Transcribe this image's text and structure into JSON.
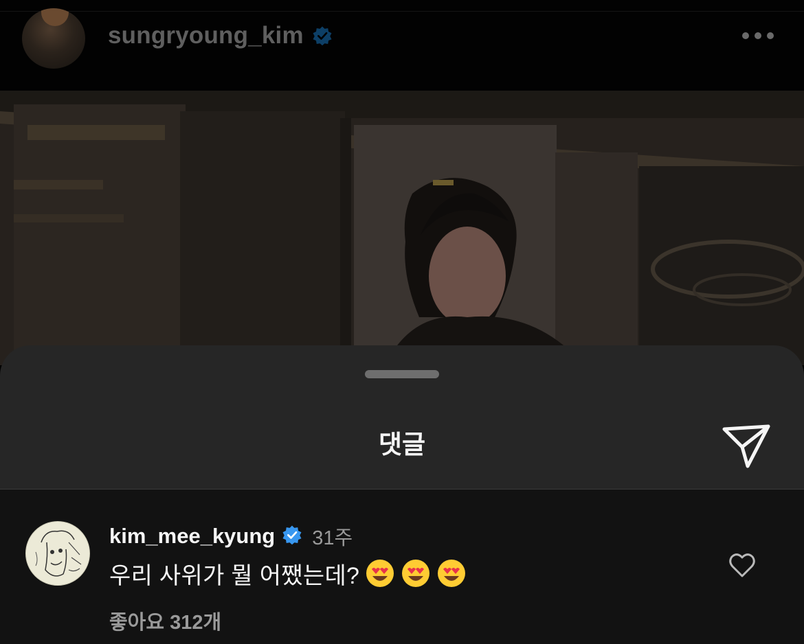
{
  "post": {
    "username": "sungryoung_kim",
    "verified": true,
    "more_icon": "ellipsis-icon",
    "photo_description_icon": "post-photo"
  },
  "comments_sheet": {
    "title": "댓글",
    "share_icon": "paper-plane-icon"
  },
  "comment": {
    "username": "kim_mee_kyung",
    "verified": true,
    "time": "31주",
    "text": "우리 사위가 뭘 어쨌는데?",
    "emojis": [
      "heart-eyes-emoji",
      "heart-eyes-emoji",
      "heart-eyes-emoji"
    ],
    "likes": "좋아요 312개",
    "like_icon": "heart-outline-icon"
  },
  "colors": {
    "sheet_bg": "#262626",
    "comment_bg": "#121212",
    "verified_blue": "#3897f0",
    "text_primary": "#f5f5f5",
    "text_secondary": "#9a9a9a"
  }
}
